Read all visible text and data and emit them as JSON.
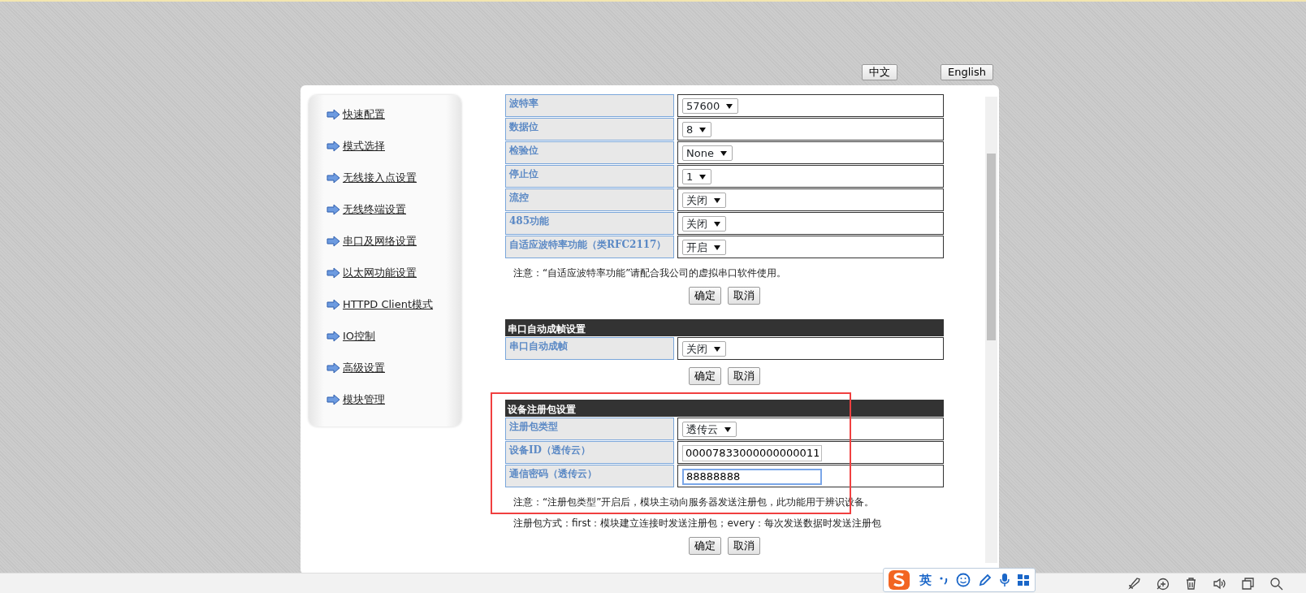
{
  "lang_buttons": [
    "中文",
    "English"
  ],
  "sidebar": {
    "items": [
      {
        "label": "快速配置"
      },
      {
        "label": "模式选择"
      },
      {
        "label": "无线接入点设置"
      },
      {
        "label": "无线终端设置"
      },
      {
        "label": "串口及网络设置"
      },
      {
        "label": "以太网功能设置"
      },
      {
        "label": "HTTPD Client模式"
      },
      {
        "label": "IO控制"
      },
      {
        "label": "高级设置"
      },
      {
        "label": "模块管理"
      }
    ]
  },
  "sections": [
    {
      "rows": [
        {
          "label": "波特率",
          "kind": "select",
          "value": "57600"
        },
        {
          "label": "数据位",
          "kind": "select",
          "value": "8"
        },
        {
          "label": "检验位",
          "kind": "select",
          "value": "None"
        },
        {
          "label": "停止位",
          "kind": "select",
          "value": "1"
        },
        {
          "label": "流控",
          "kind": "select",
          "value": "关闭"
        },
        {
          "label": "485功能",
          "kind": "select",
          "value": "关闭"
        },
        {
          "label": "自适应波特率功能（类RFC2117）",
          "kind": "select",
          "value": "开启"
        }
      ],
      "notes": [
        "注意：“自适应波特率功能”请配合我公司的虚拟串口软件使用。"
      ],
      "buttons": [
        "确定",
        "取消"
      ]
    },
    {
      "title": "串口自动成帧设置",
      "rows": [
        {
          "label": "串口自动成帧",
          "kind": "select",
          "value": "关闭"
        }
      ],
      "buttons": [
        "确定",
        "取消"
      ]
    },
    {
      "title": "设备注册包设置",
      "rows": [
        {
          "label": "注册包类型",
          "kind": "select",
          "value": "透传云"
        },
        {
          "label": "设备ID（透传云）",
          "kind": "input",
          "value": "00007833000000000011",
          "focused": false
        },
        {
          "label": "通信密码（透传云）",
          "kind": "input",
          "value": "88888888",
          "focused": true
        }
      ],
      "notes": [
        "注意：“注册包类型”开启后，模块主动向服务器发送注册包，此功能用于辨识设备。",
        "注册包方式：first：模块建立连接时发送注册包；every：每次发送数据时发送注册包"
      ],
      "buttons": [
        "确定",
        "取消"
      ]
    }
  ],
  "ime": {
    "mode": "英"
  }
}
